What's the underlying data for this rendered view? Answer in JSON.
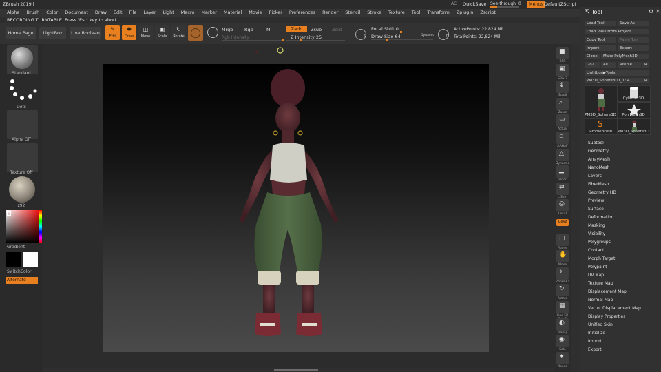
{
  "app": {
    "title": "ZBrush 2019 [",
    "ac": "AC",
    "quicksave": "QuickSave",
    "seethrough": "See-through",
    "seethrough_value": "0",
    "menus_btn": "Menus",
    "script": "DefaultZScript"
  },
  "menubar": [
    "Alpha",
    "Brush",
    "Color",
    "Document",
    "Draw",
    "Edit",
    "File",
    "Layer",
    "Light",
    "Macro",
    "Marker",
    "Material",
    "Movie",
    "Picker",
    "Preferences",
    "Render",
    "Stencil",
    "Stroke",
    "Texture",
    "Tool",
    "Transform",
    "Zplugin",
    "Zscript"
  ],
  "status": "RECORDING TURNTABLE. Press 'Esc' key to abort.",
  "toolbar": {
    "home": "Home Page",
    "lightbox": "LightBox",
    "liveboolean": "Live Boolean",
    "edit": "Edit",
    "draw": "Draw",
    "move": "Move",
    "scale": "Scale",
    "rotate": "Rotate",
    "mrgb": "Mrgb",
    "rgb": "Rgb",
    "m": "M",
    "rgb_intensity": "Rgb Intensity",
    "zadd": "Zadd",
    "zsub": "Zsub",
    "zcut": "Zcut",
    "z_intensity": "Z Intensity 25",
    "focal_shift": "Focal Shift 0",
    "draw_size": "Draw Size 64",
    "dynamic": "Dynamic",
    "active_points": "ActivePoints: 22,824 Mil",
    "total_points": "TotalPoints: 22,824 Mil",
    "s_key": "S",
    "d_key": "D"
  },
  "left": {
    "standard": "Standard",
    "dots": "Dots",
    "alpha": "Alpha Off",
    "texture": "Texture Off",
    "material": "z92",
    "gradient": "Gradient",
    "switchcolor": "SwitchColor",
    "alternate": "Alternate"
  },
  "rightstrip": [
    "BPR",
    "SPix 3",
    "Scroll",
    "Zoom",
    "Actual",
    "AAHalf",
    "Dynamic Persp",
    "Floor",
    "L.Sym",
    "Local",
    "Gxyz",
    "Frame",
    "Move",
    "Zoom3D",
    "Rotate",
    "Line Fill PolyF",
    "Transp",
    "Solo",
    "Xpose"
  ],
  "toolpanel": {
    "title": "Tool",
    "buttons": [
      "Load Tool",
      "Save As",
      "Load Tools From Project",
      "Copy Tool",
      "Paste Tool",
      "Import",
      "Export",
      "Clone",
      "Make PolyMesh3D",
      "GoZ",
      "All",
      "Visible",
      "R"
    ],
    "lightbox_tools": "Lightbox▶Tools",
    "current_tool": "PM3D_Sphere3D1_1: 41",
    "current_r": "R",
    "thumbs": [
      "PM3D_Sphere3D",
      "Cylinder3D",
      "PolyMesh3D",
      "SimpleBrush",
      "PM3D_Sphere3D"
    ],
    "items": [
      "Subtool",
      "Geometry",
      "ArrayMesh",
      "NanoMesh",
      "Layers",
      "FiberMesh",
      "Geometry HD",
      "Preview",
      "Surface",
      "Deformation",
      "Masking",
      "Visibility",
      "Polygroups",
      "Contact",
      "Morph Target",
      "Polypaint",
      "UV Map",
      "Texture Map",
      "Displacement Map",
      "Normal Map",
      "Vector Displacement Map",
      "Display Properties",
      "Unified Skin",
      "Initialize",
      "Import",
      "Export"
    ]
  },
  "colors": {
    "accent": "#e8801f",
    "panel": "#313131",
    "highlight": "#d4d46a"
  }
}
